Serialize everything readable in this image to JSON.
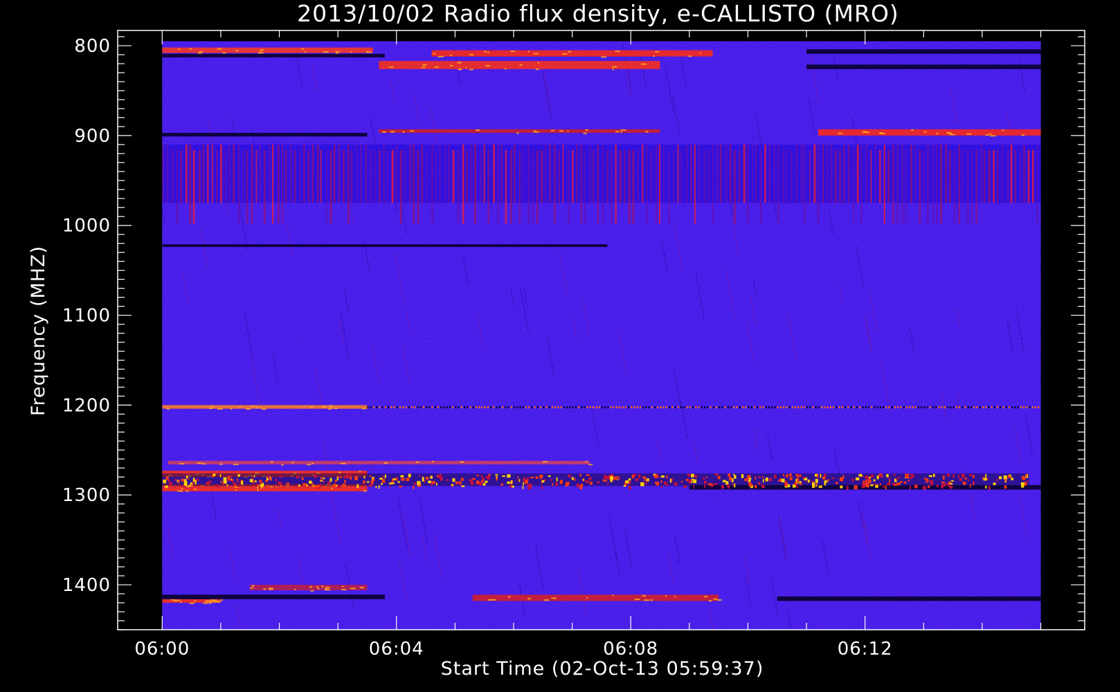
{
  "chart_data": {
    "type": "heatmap",
    "title": "2013/10/02  Radio flux density, e-CALLISTO (MRO)",
    "xlabel": "Start Time (02-Oct-13 05:59:37)",
    "ylabel": "Frequency (MHZ)",
    "x_ticks": [
      {
        "label": "06:00",
        "minutes": 0
      },
      {
        "label": "06:04",
        "minutes": 4
      },
      {
        "label": "06:08",
        "minutes": 8
      },
      {
        "label": "06:12",
        "minutes": 12
      }
    ],
    "y_ticks": [
      800,
      900,
      1000,
      1100,
      1200,
      1300,
      1400
    ],
    "xlim_minutes": [
      -0.76,
      15.75
    ],
    "data_x_range_minutes": [
      0,
      15.0
    ],
    "ylim": [
      1450,
      783
    ],
    "data_y_range": [
      795,
      1450
    ],
    "colors": {
      "background": "#3418f0",
      "low": "#0a0030",
      "mid": "#d81818",
      "high": "#ffd000"
    },
    "features": {
      "emission_bands": [
        {
          "freq_min": 802,
          "freq_max": 808,
          "t_start": 0,
          "t_end": 3.6,
          "color": "#ff3a1a"
        },
        {
          "freq_min": 805,
          "freq_max": 812,
          "t_start": 4.6,
          "t_end": 9.4,
          "color": "#ff2a10"
        },
        {
          "freq_min": 817,
          "freq_max": 826,
          "t_start": 3.7,
          "t_end": 8.5,
          "color": "#ff3010"
        },
        {
          "freq_min": 893,
          "freq_max": 897,
          "t_start": 3.7,
          "t_end": 8.5,
          "color": "#d02020"
        },
        {
          "freq_min": 893,
          "freq_max": 900,
          "t_start": 11.2,
          "t_end": 15.0,
          "color": "#ff2a10"
        },
        {
          "freq_min": 1200,
          "freq_max": 1204,
          "t_start": 0,
          "t_end": 3.5,
          "color": "#ff8020"
        },
        {
          "freq_min": 1262,
          "freq_max": 1266,
          "t_start": 0.1,
          "t_end": 7.3,
          "color": "#d04060"
        },
        {
          "freq_min": 1273,
          "freq_max": 1280,
          "t_start": 0,
          "t_end": 3.5,
          "color": "#ff3010"
        },
        {
          "freq_min": 1288,
          "freq_max": 1296,
          "t_start": 0,
          "t_end": 3.5,
          "color": "#ff3010"
        },
        {
          "freq_min": 1400,
          "freq_max": 1406,
          "t_start": 1.5,
          "t_end": 3.5,
          "color": "#c02040"
        },
        {
          "freq_min": 1411,
          "freq_max": 1418,
          "t_start": 5.3,
          "t_end": 9.5,
          "color": "#d82020"
        },
        {
          "freq_min": 1416,
          "freq_max": 1420,
          "t_start": 0,
          "t_end": 1.0,
          "color": "#ff3010"
        }
      ],
      "absorption_bands": [
        {
          "freq_min": 809,
          "freq_max": 813,
          "t_start": 0,
          "t_end": 3.8
        },
        {
          "freq_min": 804,
          "freq_max": 809,
          "t_start": 11.0,
          "t_end": 15.0
        },
        {
          "freq_min": 821,
          "freq_max": 826,
          "t_start": 11.0,
          "t_end": 15.0
        },
        {
          "freq_min": 897,
          "freq_max": 901,
          "t_start": 0,
          "t_end": 3.5
        },
        {
          "freq_min": 1021,
          "freq_max": 1024,
          "t_start": 0,
          "t_end": 7.6
        },
        {
          "freq_min": 1289,
          "freq_max": 1294,
          "t_start": 9.0,
          "t_end": 15.0
        },
        {
          "freq_min": 1411,
          "freq_max": 1416,
          "t_start": 0,
          "t_end": 3.8
        },
        {
          "freq_min": 1413,
          "freq_max": 1418,
          "t_start": 10.5,
          "t_end": 15.0
        }
      ],
      "burst_band": {
        "freq_min": 1276,
        "freq_max": 1290,
        "t_start": 0,
        "t_end": 14.8
      },
      "striped_region": {
        "freq_min": 910,
        "freq_max": 975,
        "t_start": 0,
        "t_end": 15.0
      },
      "dotted_line": {
        "freq": 1202,
        "t_start": 3.5,
        "t_end": 15.0
      }
    }
  }
}
